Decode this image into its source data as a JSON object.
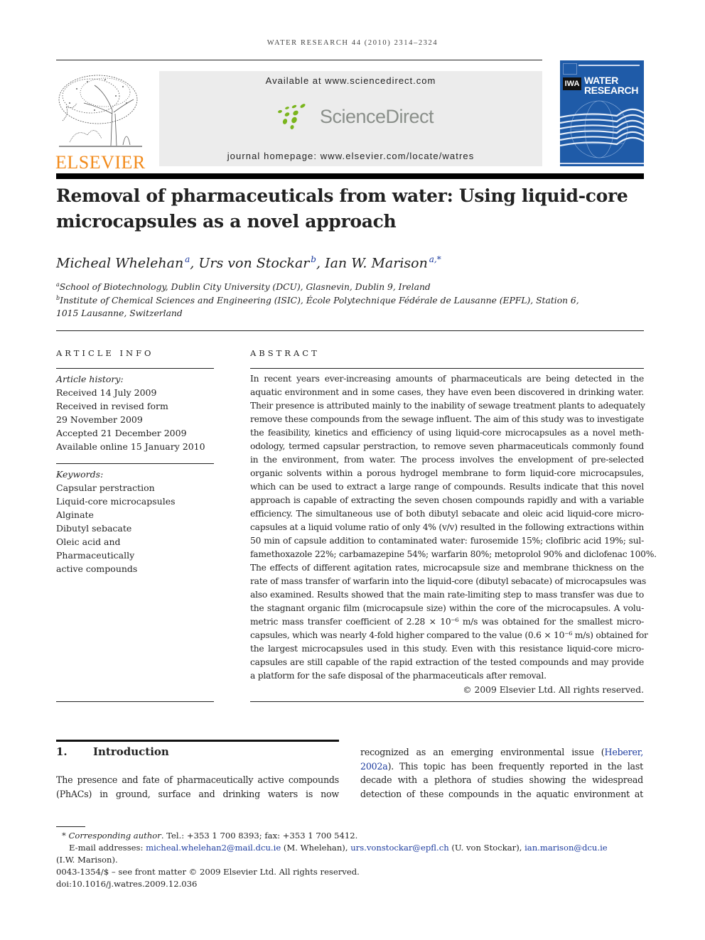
{
  "header": {
    "running_head": "WATER RESEARCH 44 (2010) 2314–2324",
    "publisher_wordmark": "ELSEVIER",
    "publisher_logo_icon": "tree-icon",
    "available_at": "Available at www.sciencedirect.com",
    "sciencedirect_wordmark": "ScienceDirect",
    "sciencedirect_logo_icon": "dots-icon",
    "journal_homepage": "journal homepage: www.elsevier.com/locate/watres",
    "cover": {
      "badge": "IWA",
      "title_line1": "WATER",
      "title_line2": "RESEARCH",
      "color": "#1f5ba8"
    },
    "brand_colors": {
      "elsevier_orange": "#f28b1c",
      "sciencedirect_green": "#7ab51d",
      "link_blue": "#1c3b9e"
    }
  },
  "article": {
    "title_line1": "Removal of pharmaceuticals from water: Using liquid-core",
    "title_line2": "microcapsules as a novel approach",
    "authors": [
      {
        "name": "Micheal Whelehan",
        "affil": "a"
      },
      {
        "name": "Urs von Stockar",
        "affil": "b"
      },
      {
        "name": "Ian W. Marison",
        "affil": "a,*"
      }
    ],
    "affiliations": [
      {
        "mark": "a",
        "text": "School of Biotechnology, Dublin City University (DCU), Glasnevin, Dublin 9, Ireland"
      },
      {
        "mark": "b",
        "text": "Institute of Chemical Sciences and Engineering (ISIC), École Polytechnique Fédérale de Lausanne (EPFL), Station 6,",
        "text_cont": "1015 Lausanne, Switzerland"
      }
    ]
  },
  "article_info": {
    "label": "ARTICLE INFO",
    "history_label": "Article history:",
    "history": [
      "Received 14 July 2009",
      "Received in revised form",
      "29 November 2009",
      "Accepted 21 December 2009",
      "Available online 15 January 2010"
    ],
    "keywords_label": "Keywords:",
    "keywords": [
      "Capsular perstraction",
      "Liquid-core microcapsules",
      "Alginate",
      "Dibutyl sebacate",
      "Oleic acid and",
      "Pharmaceutically",
      "active compounds"
    ]
  },
  "abstract": {
    "label": "ABSTRACT",
    "lines": [
      "In recent years ever-increasing amounts of pharmaceuticals are being detected in the",
      "aquatic environment and in some cases, they have even been discovered in drinking water.",
      "Their presence is attributed mainly to the inability of sewage treatment plants to adequately",
      "remove these compounds from the sewage influent. The aim of this study was to investigate",
      "the feasibility, kinetics and efficiency of using liquid-core microcapsules as a novel meth-",
      "odology, termed capsular perstraction, to remove seven pharmaceuticals commonly found",
      "in the environment, from water. The process involves the envelopment of pre-selected",
      "organic solvents within a porous hydrogel membrane to form liquid-core microcapsules,",
      "which can be used to extract a large range of compounds. Results indicate that this novel",
      "approach is capable of extracting the seven chosen compounds rapidly and with a variable",
      "efficiency. The simultaneous use of both dibutyl sebacate and oleic acid liquid-core micro-",
      "capsules at a liquid volume ratio of only 4% (v/v) resulted in the following extractions within",
      "50 min of capsule addition to contaminated water: furosemide 15%; clofibric acid 19%; sul-",
      "famethoxazole 22%; carbamazepine 54%; warfarin 80%; metoprolol 90% and diclofenac 100%.",
      "The effects of different agitation rates, microcapsule size and membrane thickness on the",
      "rate of mass transfer of warfarin into the liquid-core (dibutyl sebacate) of microcapsules was",
      "also examined. Results showed that the main rate-limiting step to mass transfer was due to",
      "the stagnant organic film (microcapsule size) within the core of the microcapsules. A volu-",
      "metric mass transfer coefficient of 2.28 × 10⁻⁶ m/s was obtained for the smallest micro-",
      "capsules, which was nearly 4-fold higher compared to the value (0.6 × 10⁻⁶ m/s) obtained for",
      "the largest microcapsules used in this study. Even with this resistance liquid-core micro-",
      "capsules are still capable of the rapid extraction of the tested compounds and may provide",
      "a platform for the safe disposal of the pharmaceuticals after removal."
    ],
    "copyright": "© 2009 Elsevier Ltd. All rights reserved."
  },
  "introduction": {
    "number": "1.",
    "heading": "Introduction",
    "left_lines": [
      "The presence and fate of pharmaceutically active compounds",
      "(PhACs) in ground, surface and drinking waters is now"
    ],
    "right_line1_pre": "recognized as an emerging environmental issue (",
    "right_cite_part1": "Heberer,",
    "right_cite_part2": "2002a",
    "right_line2_post": "). This topic has been frequently reported in the last",
    "right_lines_rest": [
      "decade with a plethora of studies showing the widespread",
      "detection of these compounds in the aquatic environment at"
    ]
  },
  "footnotes": {
    "corresponding_mark": "*",
    "corresponding_label": "Corresponding author",
    "contact": ". Tel.: +353 1 700 8393; fax: +353 1 700 5412.",
    "email_label": "E-mail addresses:",
    "emails": [
      {
        "address": "micheal.whelehan2@mail.dcu.ie",
        "owner": "(M. Whelehan),"
      },
      {
        "address": "urs.vonstockar@epfl.ch",
        "owner": "(U. von Stockar),"
      },
      {
        "address": "ian.marison@dcu.ie",
        "owner": ""
      }
    ],
    "email_tail": "(I.W. Marison).",
    "issn_line": "0043-1354/$ – see front matter © 2009 Elsevier Ltd. All rights reserved.",
    "doi": "doi:10.1016/j.watres.2009.12.036"
  }
}
